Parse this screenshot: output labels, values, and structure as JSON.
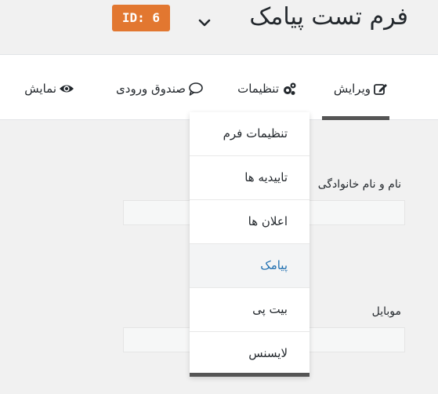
{
  "header": {
    "title": "فرم تست پیامک",
    "id_badge": "ID: 6"
  },
  "toolbar": {
    "tabs": [
      {
        "label": "ویرایش",
        "icon": "edit-icon"
      },
      {
        "label": "تنظیمات",
        "icon": "gears-icon"
      },
      {
        "label": "صندوق ورودی",
        "icon": "chat-bubble-icon"
      },
      {
        "label": "نمایش",
        "icon": "eye-icon"
      }
    ]
  },
  "settings_menu": {
    "items": [
      {
        "label": "تنظیمات فرم"
      },
      {
        "label": "تاییدیه ها"
      },
      {
        "label": "اعلان ها"
      },
      {
        "label": "پیامک"
      },
      {
        "label": "بیت پی"
      },
      {
        "label": "لایسنس"
      }
    ],
    "active": "پیامک"
  },
  "form": {
    "fields": [
      {
        "label": "نام و نام خانوادگی"
      },
      {
        "label": "موبایل"
      }
    ]
  },
  "colors": {
    "badge": "#e27730",
    "active_link": "#2271b1",
    "underline": "#555555"
  }
}
